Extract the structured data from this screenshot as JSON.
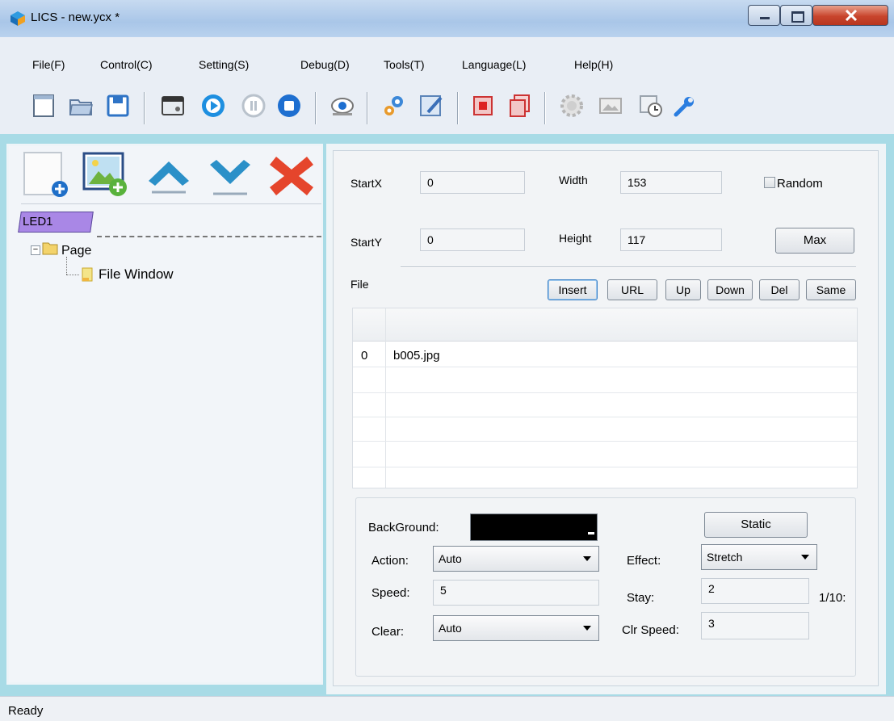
{
  "window": {
    "title": "LICS - new.ycx *"
  },
  "menu": [
    "File(F)",
    "Control(C)",
    "Setting(S)",
    "Debug(D)",
    "Tools(T)",
    "Language(L)",
    "Help(H)"
  ],
  "tree": {
    "tab": "LED1",
    "page": "Page",
    "window": "File Window"
  },
  "props": {
    "startx_label": "StartX",
    "startx": "0",
    "starty_label": "StartY",
    "starty": "0",
    "width_label": "Width",
    "width": "153",
    "height_label": "Height",
    "height": "117",
    "random_label": "Random",
    "max_label": "Max"
  },
  "file": {
    "label": "File",
    "buttons": [
      "Insert",
      "URL",
      "Up",
      "Down",
      "Del",
      "Same"
    ],
    "rows": [
      {
        "index": "0",
        "name": "b005.jpg"
      }
    ]
  },
  "settings": {
    "background_label": "BackGround:",
    "static_label": "Static",
    "action_label": "Action:",
    "action": "Auto",
    "effect_label": "Effect:",
    "effect": "Stretch",
    "speed_label": "Speed:",
    "speed": "5",
    "stay_label": "Stay:",
    "stay": "2",
    "stay_unit": "1/10:",
    "clear_label": "Clear:",
    "clear": "Auto",
    "clr_speed_label": "Clr Speed:",
    "clr_speed": "3"
  },
  "status": "Ready",
  "colors": {
    "accent_tab": "#a987e6",
    "panel_border": "#a8dbe6"
  }
}
